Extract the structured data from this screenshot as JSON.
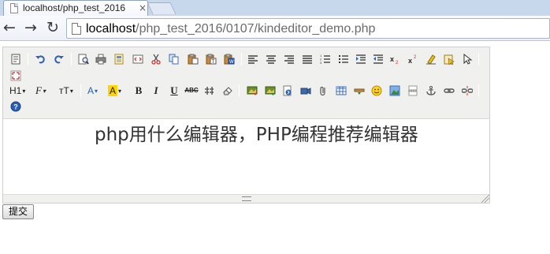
{
  "browser": {
    "tab_title": "localhost/php_test_2016",
    "tab_close": "×",
    "back_glyph": "←",
    "forward_glyph": "→",
    "reload_glyph": "↻",
    "url_host": "localhost",
    "url_path": "/php_test_2016/0107/kindeditor_demo.php"
  },
  "editor": {
    "toolbar_row1_icons": [
      "source-icon",
      "undo-icon",
      "redo-icon",
      "preview-icon",
      "print-icon",
      "template-icon",
      "code-icon",
      "cut-icon",
      "copy-icon",
      "paste-icon",
      "paste-plain-icon",
      "paste-word-icon",
      "align-left-icon",
      "align-center-icon",
      "align-right-icon",
      "justify-icon",
      "ordered-list-icon",
      "unordered-list-icon",
      "indent-icon",
      "outdent-icon",
      "subscript-icon",
      "superscript-icon",
      "clear-format-icon",
      "select-all-icon",
      "pointer-icon",
      "fullscreen-icon"
    ],
    "toolbar_row2": {
      "heading_label": "H1",
      "font_name_label": "F",
      "font_size_label": "тT",
      "font_color_label": "A",
      "highlight_label": "A",
      "bold_label": "B",
      "italic_label": "I",
      "underline_label": "U",
      "strike_label": "ABC",
      "hr_label": "",
      "highlight_color": "#ffd400",
      "font_color": "#2a62b8"
    },
    "content_text": "php用什么编辑器，PHP编程推荐编辑器"
  },
  "form": {
    "submit_label": "提交"
  }
}
